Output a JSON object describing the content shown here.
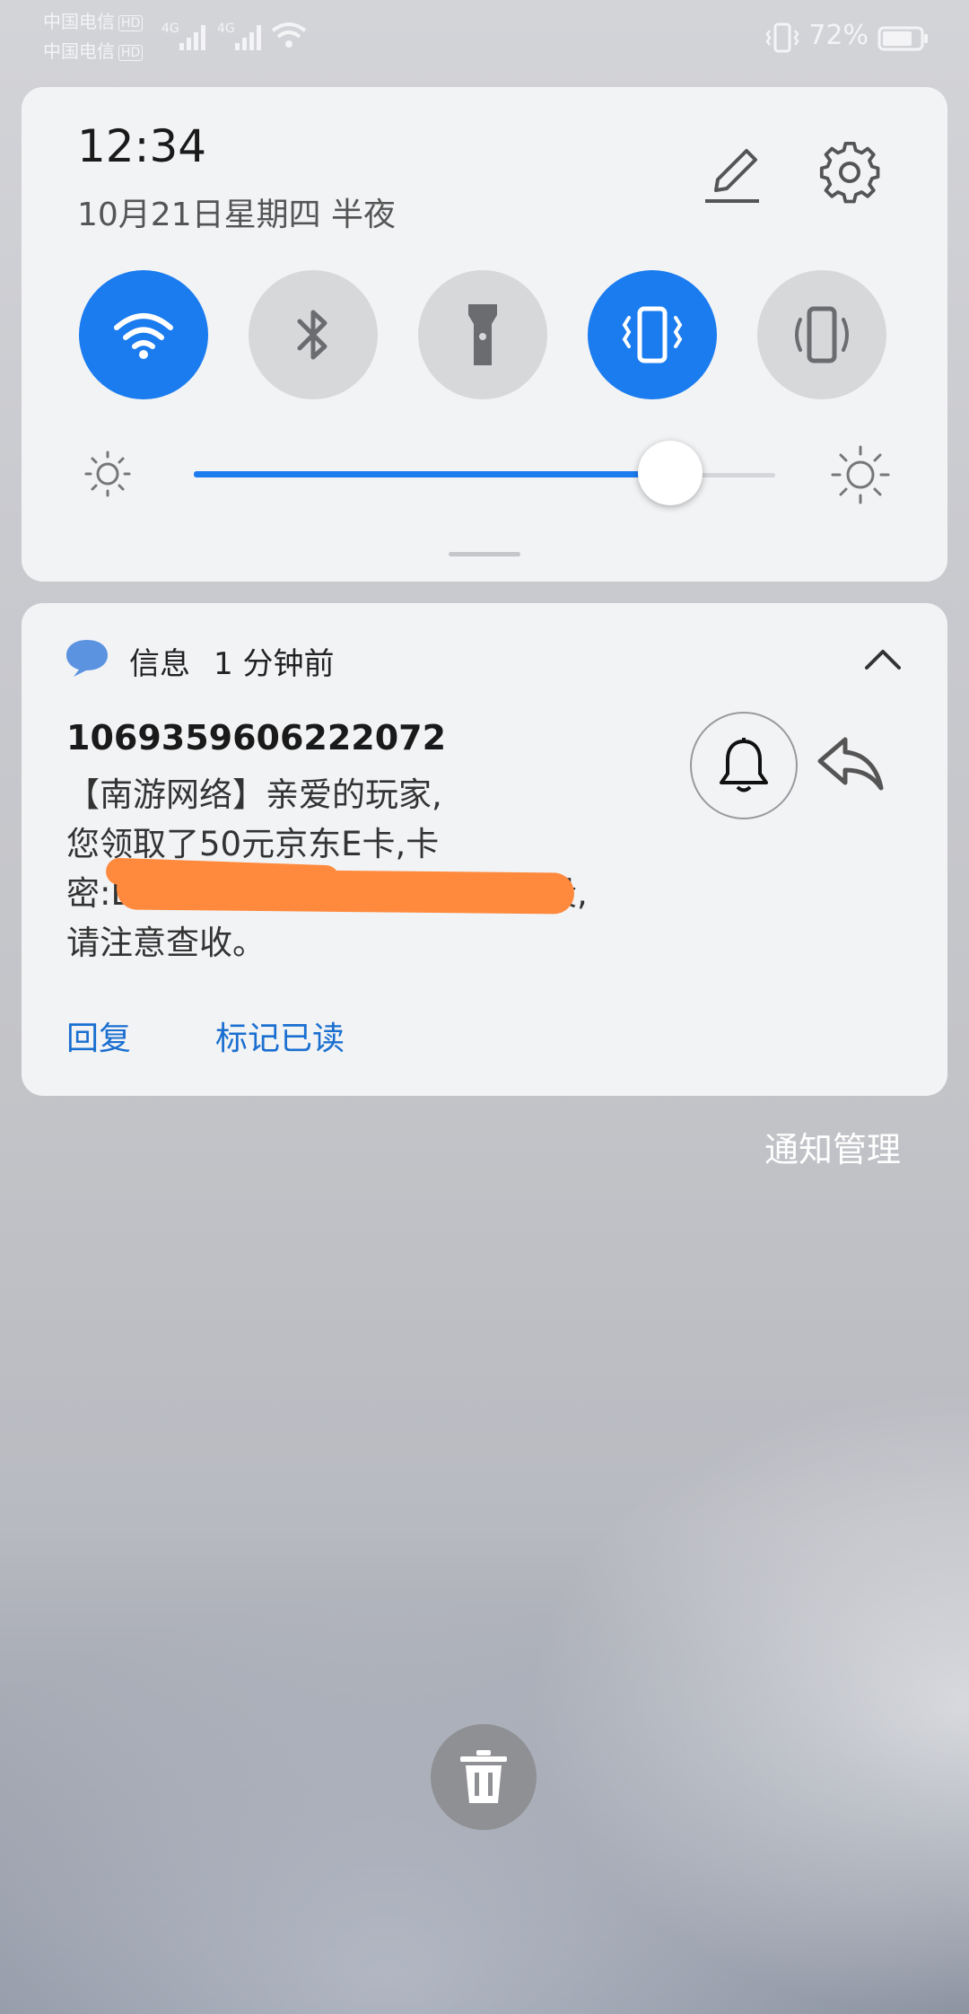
{
  "status_bar": {
    "carrier_1": "中国电信",
    "carrier_2": "中国电信",
    "hd_badge": "HD",
    "network_1": "4G",
    "network_2": "4G",
    "battery_percent": "72%",
    "icons": [
      "signal-icon",
      "wifi-icon",
      "vibrate-icon",
      "battery-icon"
    ]
  },
  "quick_settings": {
    "time": "12:34",
    "date": "10月21日星期四 半夜",
    "toggles": [
      {
        "name": "wifi",
        "icon": "wifi-icon",
        "on": true
      },
      {
        "name": "bluetooth",
        "icon": "bluetooth-icon",
        "on": false
      },
      {
        "name": "flashlight",
        "icon": "flashlight-icon",
        "on": false
      },
      {
        "name": "vibrate",
        "icon": "vibrate-icon",
        "on": true
      },
      {
        "name": "auto-rotate",
        "icon": "rotate-icon",
        "on": false
      }
    ],
    "brightness_level": 0.82,
    "accent_color": "#1b7cf0"
  },
  "notification": {
    "app_name": "信息",
    "time_ago": "1 分钟前",
    "sender": "1069359606222072",
    "body_lines": [
      "【南游网络】亲爱的玩家,",
      "您领取了50元京东E卡,卡",
      "密:D",
      "请注意查收。"
    ],
    "redaction_tail": "段,",
    "actions": {
      "reply": "回复",
      "mark_read": "标记已读"
    },
    "redaction_color": "#ff8a3d"
  },
  "notification_management": "通知管理"
}
